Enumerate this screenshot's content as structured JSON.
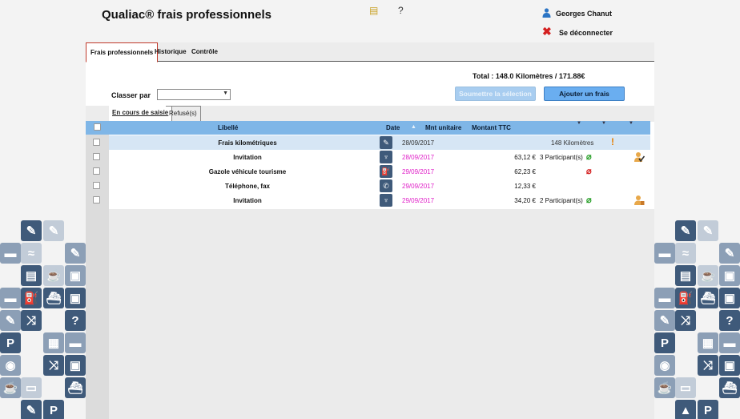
{
  "app": {
    "title": "Qualiac® frais professionnels"
  },
  "header": {
    "help_label": "?",
    "user_name": "Georges Chanut",
    "logout_label": "Se déconnecter"
  },
  "tabs": [
    "Frais professionnels",
    "Historique",
    "Contrôle"
  ],
  "summary": {
    "total": "Total : 148.0 Kilomètres / 171.88€"
  },
  "sort": {
    "label": "Classer par",
    "value": ""
  },
  "buttons": {
    "submit": "Soumettre la sélection",
    "add": "Ajouter un frais"
  },
  "subtabs": [
    "En cours de saisie",
    "Refusé(s)"
  ],
  "table": {
    "headers": {
      "libelle": "Libellé",
      "date": "Date",
      "mnt_unitaire": "Mnt unitaire",
      "montant_ttc": "Montant TTC"
    },
    "rows": [
      {
        "libelle": "Frais kilométriques",
        "icon": "pencil-icon",
        "date": "28/09/2017",
        "montant": "",
        "extra": "148 Kilomètres",
        "highlight": true,
        "date_color": "#333333",
        "clip": "",
        "status": "warning-icon"
      },
      {
        "libelle": "Invitation",
        "icon": "restaurant-icon",
        "date": "28/09/2017",
        "montant": "63,12 €",
        "extra": "3 Participant(s)",
        "highlight": false,
        "date_color": "#e020c8",
        "clip": "green",
        "status": "user-check-icon"
      },
      {
        "libelle": "Gazole véhicule tourisme",
        "icon": "fuel-icon",
        "date": "29/09/2017",
        "montant": "62,23 €",
        "extra": "",
        "highlight": false,
        "date_color": "#e020c8",
        "clip": "red",
        "status": ""
      },
      {
        "libelle": "Téléphone, fax",
        "icon": "phone-icon",
        "date": "29/09/2017",
        "montant": "12,33 €",
        "extra": "",
        "highlight": false,
        "date_color": "#e020c8",
        "clip": "",
        "status": ""
      },
      {
        "libelle": "Invitation",
        "icon": "restaurant-icon",
        "date": "29/09/2017",
        "montant": "34,20 €",
        "extra": "2 Participant(s)",
        "highlight": false,
        "date_color": "#e020c8",
        "clip": "green",
        "status": "user-icon"
      }
    ]
  },
  "colors": {
    "accent": "#7fb6e7",
    "tile": "#3f5a7a",
    "late_date": "#e020c8"
  },
  "decor_tiles": {
    "left": [
      "P",
      "P"
    ],
    "right": [
      "P",
      "P"
    ]
  }
}
